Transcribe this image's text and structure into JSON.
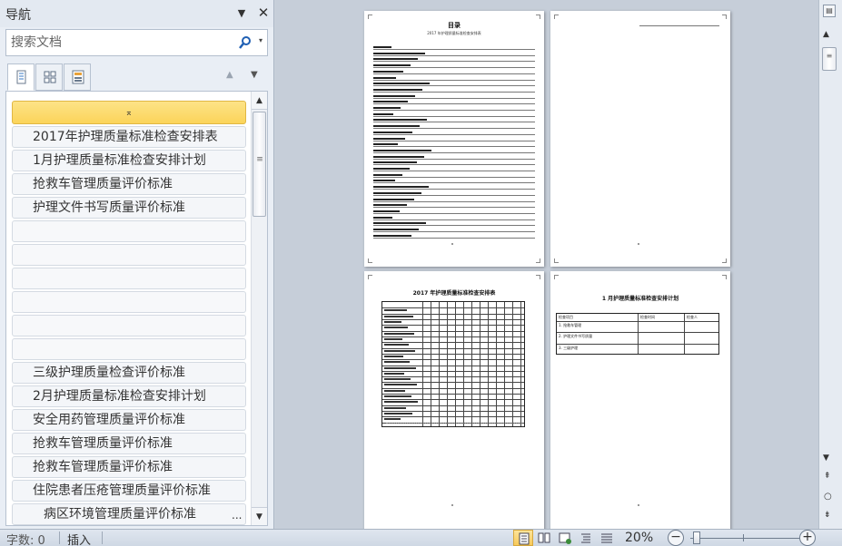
{
  "nav_pane": {
    "title": "导航",
    "dropdown_glyph": "▼",
    "close_glyph": "✕",
    "search": {
      "placeholder": "搜索文档",
      "value": "",
      "options_glyph": "▾"
    },
    "tabs": [
      {
        "icon": "headings-tab-icon"
      },
      {
        "icon": "thumbnails-tab-icon"
      },
      {
        "icon": "results-tab-icon"
      }
    ],
    "prev_glyph": "▲",
    "next_glyph": "▼",
    "collapse_glyph": "⌅",
    "headings": [
      "2017年护理质量标准检查安排表",
      "1月护理质量标准检查安排计划",
      "抢救车管理质量评价标准",
      "护理文件书写质量评价标准",
      "",
      "",
      "",
      "",
      "",
      "",
      "三级护理质量检查评价标准",
      "2月护理质量标准检查安排计划",
      "安全用药管理质量评价标准",
      "抢救车管理质量评价标准",
      "抢救车管理质量评价标准",
      "住院患者压疮管理质量评价标准",
      "病区环境管理质量评价标准"
    ],
    "ellipsis": "...",
    "scroll_up": "▲",
    "scroll_down": "▼",
    "scroll_grip": "≡"
  },
  "document": {
    "page1": {
      "title": "目录",
      "subtitle": "2017 年护理质量标准检查安排表",
      "toc_count": 32
    },
    "page3": {
      "title": "2017 年护理质量标准检查安排表"
    },
    "page4": {
      "title": "1 月护理质量标准检查安排计划",
      "table": {
        "headers": [
          "检查项目",
          "检查时间",
          "检查人"
        ],
        "rows": [
          "1. 抢救车管理",
          "2. 护理文件书写质量",
          "3. 三级护理"
        ]
      }
    }
  },
  "right_bar": {
    "ruler_glyph": "▤",
    "up": "▲",
    "down": "▼",
    "grip": "≡",
    "prev_page": "⇞",
    "browse": "○",
    "next_page": "⇟"
  },
  "status_bar": {
    "word_count": "字数: 0",
    "mode": "插入",
    "zoom": "20%",
    "zoom_out": "−",
    "zoom_in": "+"
  },
  "colors": {
    "accent": "#fbd45a",
    "pane_bg": "#e9eef5",
    "doc_bg": "#c6ced9"
  }
}
